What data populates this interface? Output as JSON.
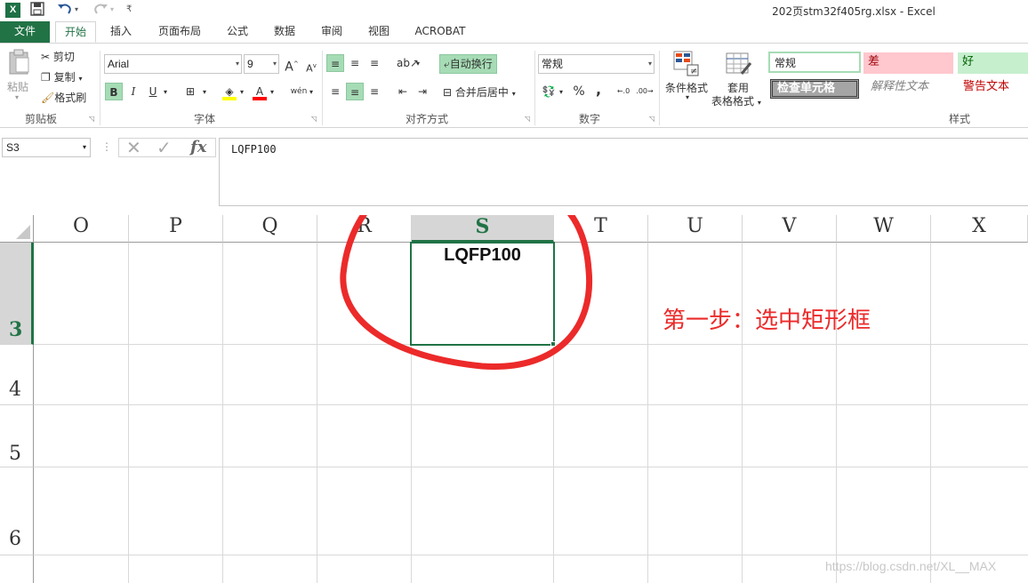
{
  "window": {
    "title": "202页stm32f405rg.xlsx - Excel",
    "logo": "X"
  },
  "tabs": [
    "文件",
    "开始",
    "插入",
    "页面布局",
    "公式",
    "数据",
    "审阅",
    "视图",
    "ACROBAT"
  ],
  "ribbon": {
    "clipboard": {
      "paste": "粘贴",
      "cut": "剪切",
      "copy": "复制",
      "format_painter": "格式刷",
      "label": "剪贴板"
    },
    "font": {
      "name": "Arial",
      "size": "9",
      "bold": "B",
      "italic": "I",
      "underline": "U",
      "grow": "A",
      "shrink": "A",
      "label": "字体",
      "phonetic": "wén"
    },
    "alignment": {
      "wrap": "自动换行",
      "merge": "合并后居中",
      "label": "对齐方式"
    },
    "number": {
      "format": "常规",
      "percent": "%",
      "comma": ",",
      "label": "数字"
    },
    "styles": {
      "conditional": "条件格式",
      "table_format_1": "套用",
      "table_format_2": "表格格式",
      "normal": "常规",
      "bad": "差",
      "good": "好",
      "check_cell": "检查单元格",
      "explanatory": "解释性文本",
      "warning": "警告文本",
      "label": "样式",
      "colors": {
        "bad_bg": "#ffc7ce",
        "good_bg": "#c6efce",
        "warning_text": "#c00000"
      }
    }
  },
  "formula_bar": {
    "name_box": "S3",
    "fx": "fx",
    "content": "LQFP100"
  },
  "sheet": {
    "columns": [
      "O",
      "P",
      "Q",
      "R",
      "S",
      "T",
      "U",
      "V",
      "W",
      "X"
    ],
    "selected_column": "S",
    "rows": [
      "3",
      "4",
      "5",
      "6"
    ],
    "selected_row": "3",
    "cell_value": "LQFP100",
    "accent": "#217346"
  },
  "annotation": {
    "text": "第一步：选中矩形框",
    "color": "#ec2a2a"
  },
  "watermark": "https://blog.csdn.net/XL__MAX"
}
